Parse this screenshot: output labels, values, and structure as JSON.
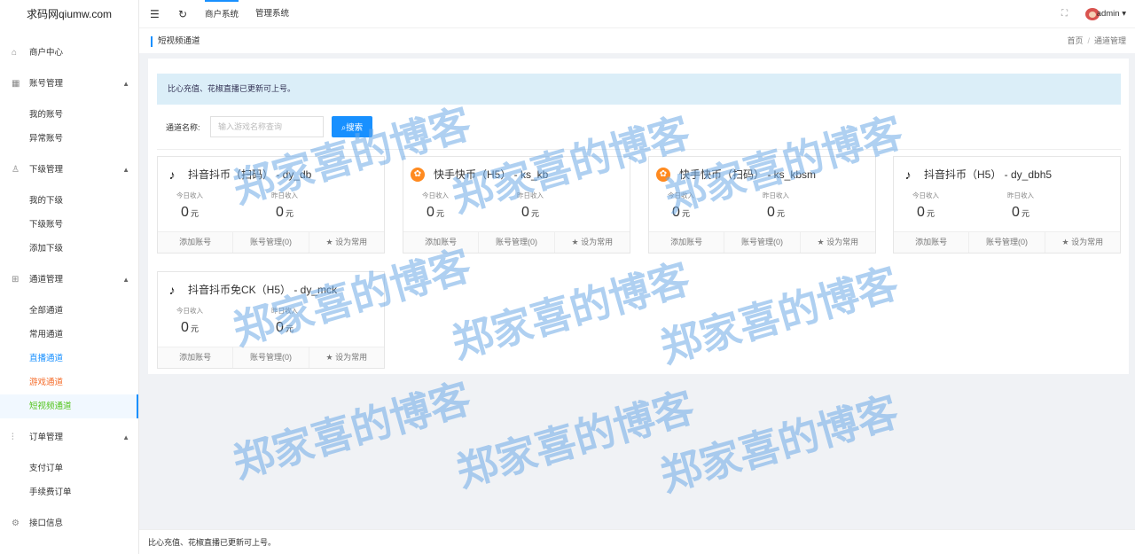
{
  "site": {
    "title": "求码网qiumw.com"
  },
  "topbar": {
    "tabs": [
      "商户系统",
      "管理系统"
    ],
    "user": "admin ▾"
  },
  "sidebar": {
    "merchant": "商户中心",
    "account_mgmt": "账号管理",
    "my_account": "我的账号",
    "abnormal_account": "异常账号",
    "sub_mgmt": "下级管理",
    "my_sub": "我的下级",
    "sub_account": "下级账号",
    "add_sub": "添加下级",
    "channel_mgmt": "通道管理",
    "all_channels": "全部通道",
    "common_channels": "常用通道",
    "live_channels": "直播通道",
    "game_channels": "游戏通道",
    "short_video_channels": "短视频通道",
    "order_mgmt": "订单管理",
    "pay_orders": "支付订单",
    "fee_orders": "手续费订单",
    "api_info": "接口信息"
  },
  "page": {
    "title": "短视频通道",
    "breadcrumb_home": "首页",
    "breadcrumb_sep": "/",
    "breadcrumb_current": "通道管理"
  },
  "notice": "比心充值、花椒直播已更新可上号。",
  "search": {
    "label": "通道名称:",
    "placeholder": "输入游戏名称查询",
    "button": "搜索"
  },
  "cards": [
    {
      "title": "抖音抖币（扫码）  - dy_db",
      "icon": "tiktok-icon"
    },
    {
      "title": "快手快币（H5） - ks_kb",
      "icon": "kuaishou-icon"
    },
    {
      "title": "快手快币（扫码） - ks_kbsm",
      "icon": "kuaishou-icon"
    },
    {
      "title": "抖音抖币（H5） - dy_dbh5",
      "icon": "tiktok-icon"
    },
    {
      "title": "抖音抖币免CK（H5） - dy_mck",
      "icon": "tiktok-icon"
    }
  ],
  "card_common": {
    "today_label": "今日收入",
    "yesterday_label": "昨日收入",
    "today_value": "0",
    "yesterday_value": "0",
    "unit": "元",
    "action_add": "添加账号",
    "action_manage": "账号管理(0)",
    "action_fav": "设为常用"
  },
  "footer": "比心充值、花椒直播已更新可上号。",
  "watermark": "郑家喜的博客",
  "colors": {
    "accent": "#1890ff",
    "active_menu": "#52c41a",
    "game_menu": "#f56c2a"
  }
}
